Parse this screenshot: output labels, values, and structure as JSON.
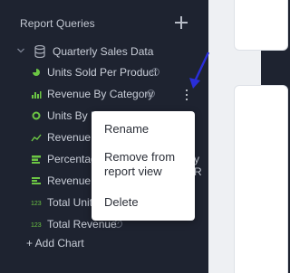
{
  "sidebar": {
    "title": "Report Queries",
    "dataset": {
      "label": "Quarterly Sales Data"
    },
    "items": [
      {
        "label": "Units Sold Per Product",
        "icon": "pie-chart-icon"
      },
      {
        "label": "Revenue By Category",
        "icon": "bar-chart-icon"
      },
      {
        "label": "Units By R",
        "icon": "donut-chart-icon"
      },
      {
        "label": "Revenue T",
        "icon": "line-chart-icon"
      },
      {
        "label": "Percentage",
        "icon": "stacked-bar-icon"
      },
      {
        "label": "Revenue H",
        "icon": "horizontal-bar-icon"
      },
      {
        "label": "Total Units",
        "icon": "number-icon"
      },
      {
        "label": "Total Revenue",
        "icon": "number-icon"
      }
    ],
    "add_chart_label": "+ Add Chart",
    "overflow_label_fragment": "y R"
  },
  "context_menu": {
    "items": [
      {
        "label": "Rename"
      },
      {
        "label_line1": "Remove from",
        "label_line2": "report view"
      },
      {
        "label": "Delete"
      }
    ]
  },
  "colors": {
    "sidebar_bg": "#1e2330",
    "accent_green": "#6cc644",
    "annotation_arrow": "#2a2ed9",
    "menu_bg": "#ffffff"
  }
}
